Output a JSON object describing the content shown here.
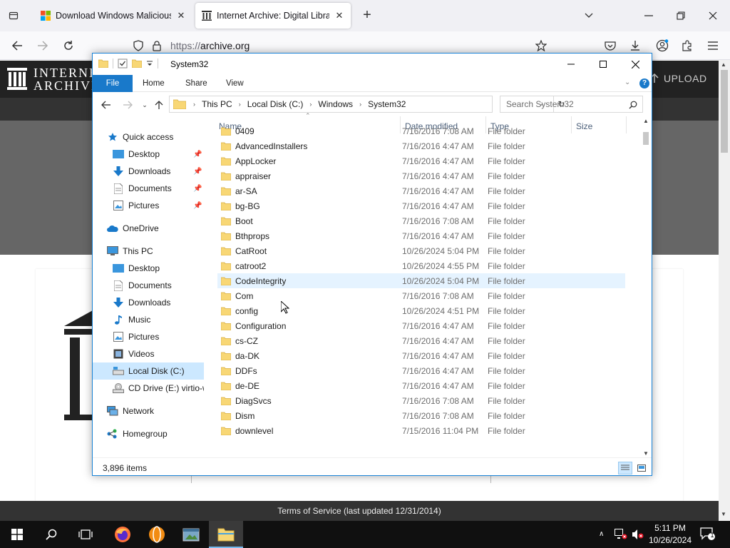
{
  "browser": {
    "tabs": [
      {
        "label": "Download Windows Malicious"
      },
      {
        "label": "Internet Archive: Digital Library"
      }
    ],
    "url_scheme": "https://",
    "url_host": "archive.org"
  },
  "archive_page": {
    "logo_line1": "INTERNET",
    "logo_line2": "ARCHIVE",
    "upload_label": "UPLOAD",
    "footer_text": "Terms of Service (last updated 12/31/2014)"
  },
  "explorer": {
    "title": "System32",
    "ribbon_tabs": [
      "File",
      "Home",
      "Share",
      "View"
    ],
    "breadcrumb": [
      "This PC",
      "Local Disk (C:)",
      "Windows",
      "System32"
    ],
    "search_placeholder": "Search System32",
    "columns": [
      "Name",
      "Date modified",
      "Type",
      "Size"
    ],
    "nav": {
      "quick_access": "Quick access",
      "quick_items": [
        "Desktop",
        "Downloads",
        "Documents",
        "Pictures"
      ],
      "onedrive": "OneDrive",
      "this_pc": "This PC",
      "pc_items": [
        "Desktop",
        "Documents",
        "Downloads",
        "Music",
        "Pictures",
        "Videos",
        "Local Disk (C:)",
        "CD Drive (E:) virtio-win"
      ],
      "network": "Network",
      "homegroup": "Homegroup"
    },
    "files": [
      {
        "name": "0409",
        "date": "7/16/2016 7:08 AM",
        "type": "File folder"
      },
      {
        "name": "AdvancedInstallers",
        "date": "7/16/2016 4:47 AM",
        "type": "File folder"
      },
      {
        "name": "AppLocker",
        "date": "7/16/2016 4:47 AM",
        "type": "File folder"
      },
      {
        "name": "appraiser",
        "date": "7/16/2016 4:47 AM",
        "type": "File folder"
      },
      {
        "name": "ar-SA",
        "date": "7/16/2016 4:47 AM",
        "type": "File folder"
      },
      {
        "name": "bg-BG",
        "date": "7/16/2016 4:47 AM",
        "type": "File folder"
      },
      {
        "name": "Boot",
        "date": "7/16/2016 7:08 AM",
        "type": "File folder"
      },
      {
        "name": "Bthprops",
        "date": "7/16/2016 4:47 AM",
        "type": "File folder"
      },
      {
        "name": "CatRoot",
        "date": "10/26/2024 5:04 PM",
        "type": "File folder"
      },
      {
        "name": "catroot2",
        "date": "10/26/2024 4:55 PM",
        "type": "File folder"
      },
      {
        "name": "CodeIntegrity",
        "date": "10/26/2024 5:04 PM",
        "type": "File folder"
      },
      {
        "name": "Com",
        "date": "7/16/2016 7:08 AM",
        "type": "File folder"
      },
      {
        "name": "config",
        "date": "10/26/2024 4:51 PM",
        "type": "File folder"
      },
      {
        "name": "Configuration",
        "date": "7/16/2016 4:47 AM",
        "type": "File folder"
      },
      {
        "name": "cs-CZ",
        "date": "7/16/2016 4:47 AM",
        "type": "File folder"
      },
      {
        "name": "da-DK",
        "date": "7/16/2016 4:47 AM",
        "type": "File folder"
      },
      {
        "name": "DDFs",
        "date": "7/16/2016 4:47 AM",
        "type": "File folder"
      },
      {
        "name": "de-DE",
        "date": "7/16/2016 4:47 AM",
        "type": "File folder"
      },
      {
        "name": "DiagSvcs",
        "date": "7/16/2016 7:08 AM",
        "type": "File folder"
      },
      {
        "name": "Dism",
        "date": "7/16/2016 7:08 AM",
        "type": "File folder"
      },
      {
        "name": "downlevel",
        "date": "7/15/2016 11:04 PM",
        "type": "File folder"
      }
    ],
    "status_count": "3,896 items"
  },
  "taskbar": {
    "time": "5:11 PM",
    "date": "10/26/2024",
    "notification_count": "1"
  },
  "colors": {
    "accent": "#1979ca",
    "folder": "#f8d775",
    "selection": "#cce8ff",
    "hover": "#e5f3ff",
    "taskbar": "#101010"
  }
}
